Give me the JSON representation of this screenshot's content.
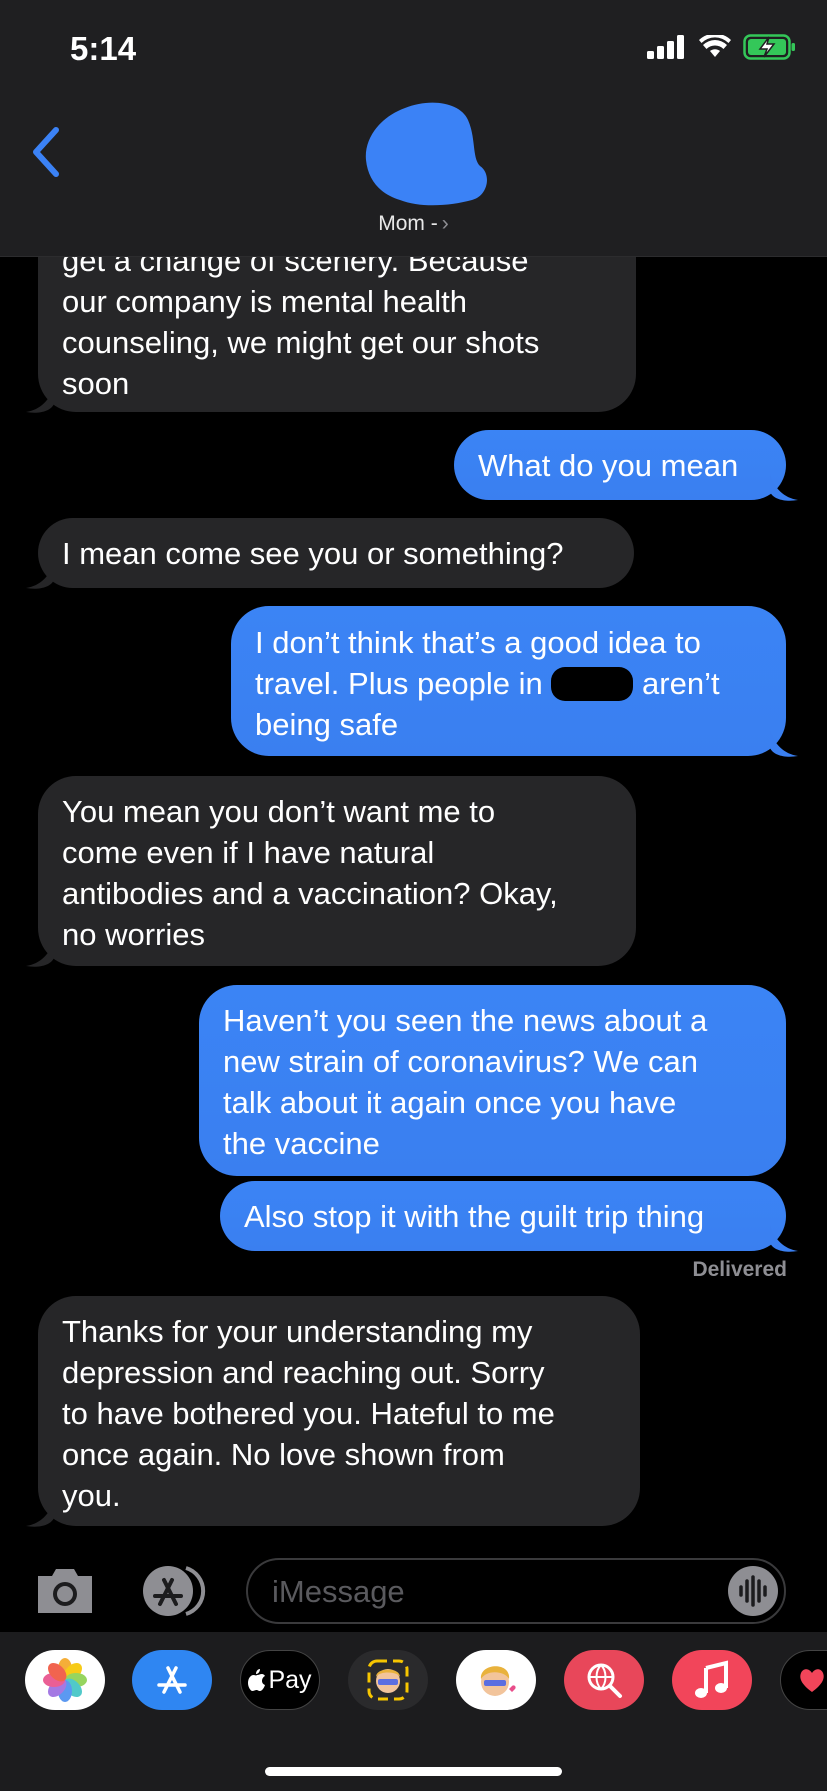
{
  "status": {
    "time": "5:14"
  },
  "contact": {
    "name": "Mom -",
    "chevron": "›"
  },
  "messages": [
    {
      "dir": "in",
      "lines": [
        "get a change of scenery. Because",
        "our company is mental health",
        "counseling, we might get our shots",
        "soon"
      ]
    },
    {
      "dir": "out",
      "text": "What do you mean"
    },
    {
      "dir": "in",
      "text": "I mean come see you or something?"
    },
    {
      "dir": "out",
      "lines": [
        "I don’t think that’s a good idea to",
        "travel. Plus people in",
        "aren’t",
        "being safe"
      ]
    },
    {
      "dir": "in",
      "lines": [
        "You mean you don’t want me to",
        "come even if I have natural",
        "antibodies and a vaccination? Okay,",
        "no worries"
      ]
    },
    {
      "dir": "out",
      "lines": [
        "Haven’t you seen the news about a",
        "new strain of coronavirus? We can",
        "talk about it again once you have",
        "the vaccine"
      ]
    },
    {
      "dir": "out",
      "text": "Also stop it with the guilt trip thing"
    },
    {
      "dir": "in",
      "lines": [
        "Thanks for your understanding my",
        "depression and reaching out. Sorry",
        "to have bothered you. Hateful to me",
        "once again. No love shown from",
        "you."
      ]
    }
  ],
  "delivered": "Delivered",
  "composer": {
    "placeholder": "iMessage"
  },
  "apps": [
    {
      "name": "Photos",
      "icon": "photos-icon"
    },
    {
      "name": "App Store",
      "icon": "appstore-icon"
    },
    {
      "name": "Apple Pay",
      "label": "Pay",
      "icon": "applepay-icon"
    },
    {
      "name": "Memoji",
      "icon": "memoji-icon"
    },
    {
      "name": "Memoji Stickers",
      "icon": "memoji-stickers-icon"
    },
    {
      "name": "Search",
      "icon": "globe-search-icon"
    },
    {
      "name": "Music",
      "icon": "music-icon"
    },
    {
      "name": "Digital Touch",
      "icon": "heart-icon"
    }
  ],
  "colors": {
    "outgoing": "#3b82f6",
    "incoming": "#262628",
    "accent": "#3b82f6"
  }
}
